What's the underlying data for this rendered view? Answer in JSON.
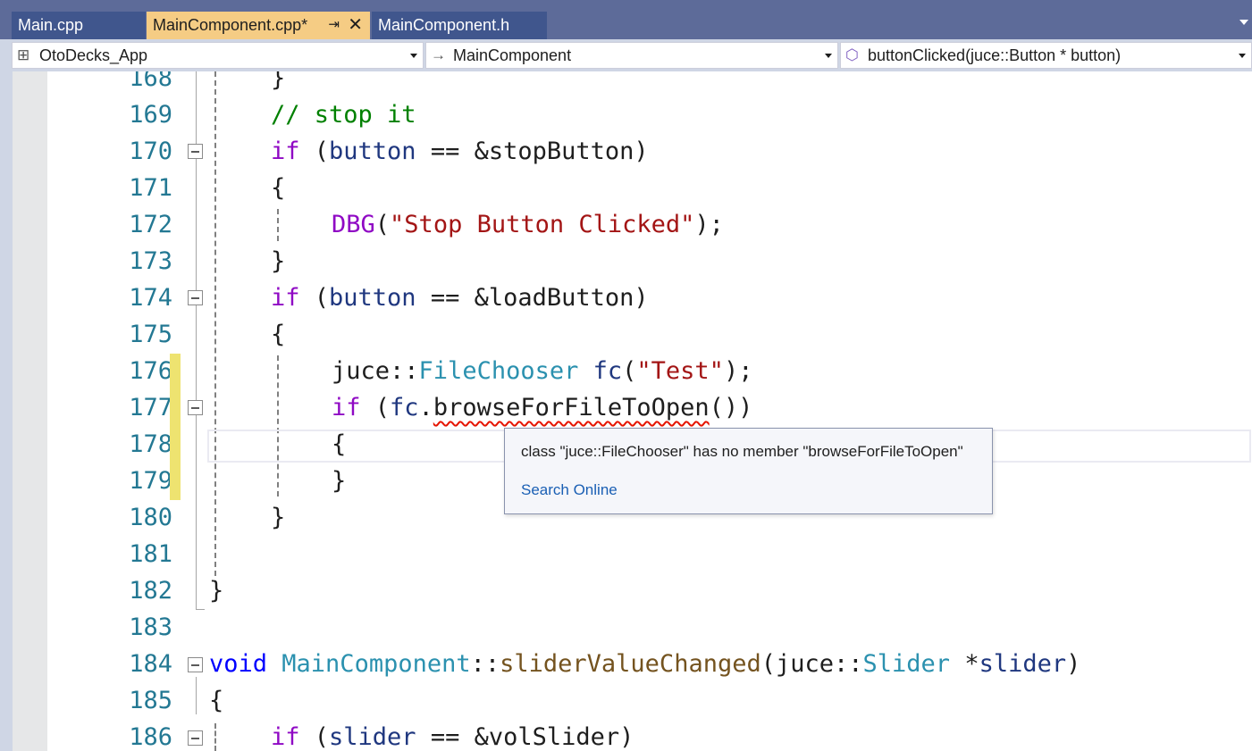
{
  "tabs": [
    {
      "label": "Main.cpp",
      "active": false
    },
    {
      "label": "MainComponent.cpp*",
      "active": true
    },
    {
      "label": "MainComponent.h",
      "active": false
    }
  ],
  "tab_pin_icon": "pin-icon",
  "tab_close_icon": "close-icon",
  "navbar": {
    "project": "OtoDecks_App",
    "scope": "MainComponent",
    "member": "buttonClicked(juce::Button * button)"
  },
  "code": {
    "line_numbers": [
      "168",
      "169",
      "170",
      "171",
      "172",
      "173",
      "174",
      "175",
      "176",
      "177",
      "178",
      "179",
      "180",
      "181",
      "182",
      "183",
      "184",
      "185",
      "186"
    ],
    "l168": "}",
    "l169": "// stop it",
    "l170_kw": "if",
    "l170_a": " (",
    "l170_var": "button",
    "l170_b": " == &stopButton)",
    "l171": "{",
    "l172_mac": "DBG",
    "l172_a": "(",
    "l172_str": "\"Stop Button Clicked\"",
    "l172_b": ");",
    "l173": "}",
    "l174_kw": "if",
    "l174_a": " (",
    "l174_var": "button",
    "l174_b": " == &loadButton)",
    "l175": "{",
    "l176_ns": "juce::",
    "l176_type": "FileChooser",
    "l176_var": " fc",
    "l176_a": "(",
    "l176_str": "\"Test\"",
    "l176_b": ");",
    "l177_kw": "if",
    "l177_a": " (",
    "l177_var": "fc",
    "l177_b": ".",
    "l177_err": "browseForFileToOpen",
    "l177_c": "())",
    "l178": "{",
    "l179": "}",
    "l180": "}",
    "l182": "}",
    "l184_kw": "void",
    "l184_cls": " MainComponent",
    "l184_a": "::",
    "l184_fn": "sliderValueChanged",
    "l184_b": "(juce::",
    "l184_type": "Slider",
    "l184_c": " *",
    "l184_var": "slider",
    "l184_d": ")",
    "l185": "{",
    "l186_kw": "if",
    "l186_a": " (",
    "l186_var": "slider",
    "l186_b": " == &volSlider)"
  },
  "tooltip": {
    "message": "class \"juce::FileChooser\" has no member \"browseForFileToOpen\"",
    "link": "Search Online"
  },
  "colors": {
    "tab_strip": "#5d6b99",
    "active_tab": "#f5cc84",
    "keyword": "#8f08c4",
    "keyword_blue": "#0000ff",
    "comment": "#008000",
    "string": "#a31515",
    "type": "#2b91af",
    "function": "#74531f",
    "line_number": "#237893",
    "change_bar": "#eee370",
    "error_squiggle": "#e51400"
  }
}
